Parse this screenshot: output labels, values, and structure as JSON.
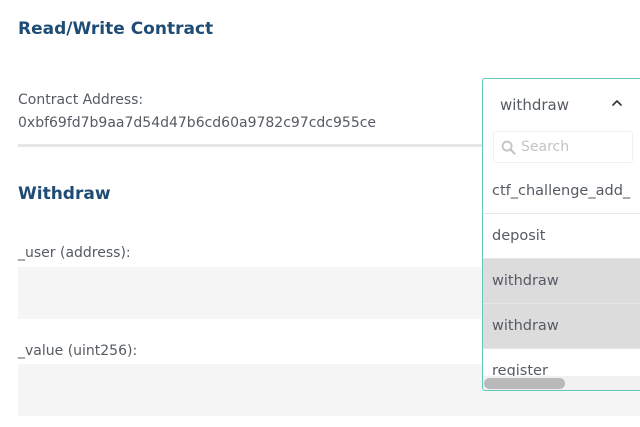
{
  "header": {
    "title": "Read/Write Contract"
  },
  "contract": {
    "address_label": "Contract Address:",
    "address_value": "0xbf69fd7b9aa7d54d47b6cd60a9782c97cdc955ce"
  },
  "function_form": {
    "title": "Withdraw",
    "fields": [
      {
        "label": "_user (address):",
        "value": ""
      },
      {
        "label": "_value (uint256):",
        "value": ""
      }
    ]
  },
  "dropdown": {
    "selected": "withdraw",
    "chevron_icon": "chevron-up-icon",
    "search_icon": "search-icon",
    "search_placeholder": "Search",
    "options": [
      {
        "label": "ctf_challenge_add_",
        "hovered": false
      },
      {
        "label": "deposit",
        "hovered": false
      },
      {
        "label": "withdraw",
        "hovered": true
      },
      {
        "label": "withdraw",
        "hovered": true
      },
      {
        "label": "register",
        "hovered": false
      }
    ]
  },
  "colors": {
    "heading": "#1f4c74",
    "text": "#555b62",
    "dropdown_border": "#5fc9b3",
    "input_background": "#f5f5f5",
    "option_hover": "#dcdcdc"
  }
}
